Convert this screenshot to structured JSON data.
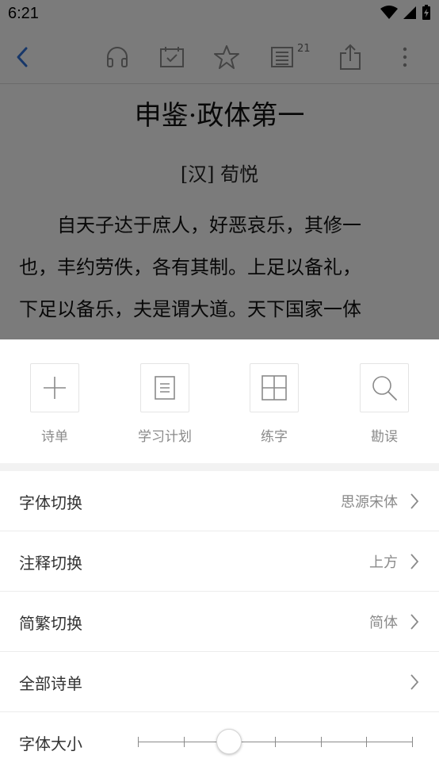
{
  "status": {
    "time": "6:21"
  },
  "toolbar": {
    "back_icon": "chevron-left-icon",
    "icons": [
      "headphones-icon",
      "calendar-check-icon",
      "star-icon",
      "book-list-icon",
      "share-icon",
      "more-vertical-icon"
    ],
    "badge_count": "21"
  },
  "chapter": {
    "title": "申鉴·政体第一",
    "author": "[汉] 荀悦",
    "lines": [
      "自天子达于庶人，好恶哀乐，其修一",
      "也，丰约劳佚，各有其制。上足以备礼，",
      "下足以备乐，夫是谓大道。天下国家一体"
    ]
  },
  "tools": [
    {
      "label": "诗单",
      "icon": "plus-icon"
    },
    {
      "label": "学习计划",
      "icon": "document-icon"
    },
    {
      "label": "练字",
      "icon": "grid-icon"
    },
    {
      "label": "勘误",
      "icon": "search-icon"
    }
  ],
  "settings": {
    "font_switch": {
      "label": "字体切换",
      "value": "思源宋体"
    },
    "note_switch": {
      "label": "注释切换",
      "value": "上方"
    },
    "script_switch": {
      "label": "简繁切换",
      "value": "简体"
    },
    "all_poems": {
      "label": "全部诗单"
    },
    "font_size": {
      "label": "字体大小",
      "level": 2,
      "steps": 7
    }
  },
  "colors": {
    "accent": "#2e6fd3",
    "text_primary": "#333333",
    "text_secondary": "#8a8a8a"
  }
}
